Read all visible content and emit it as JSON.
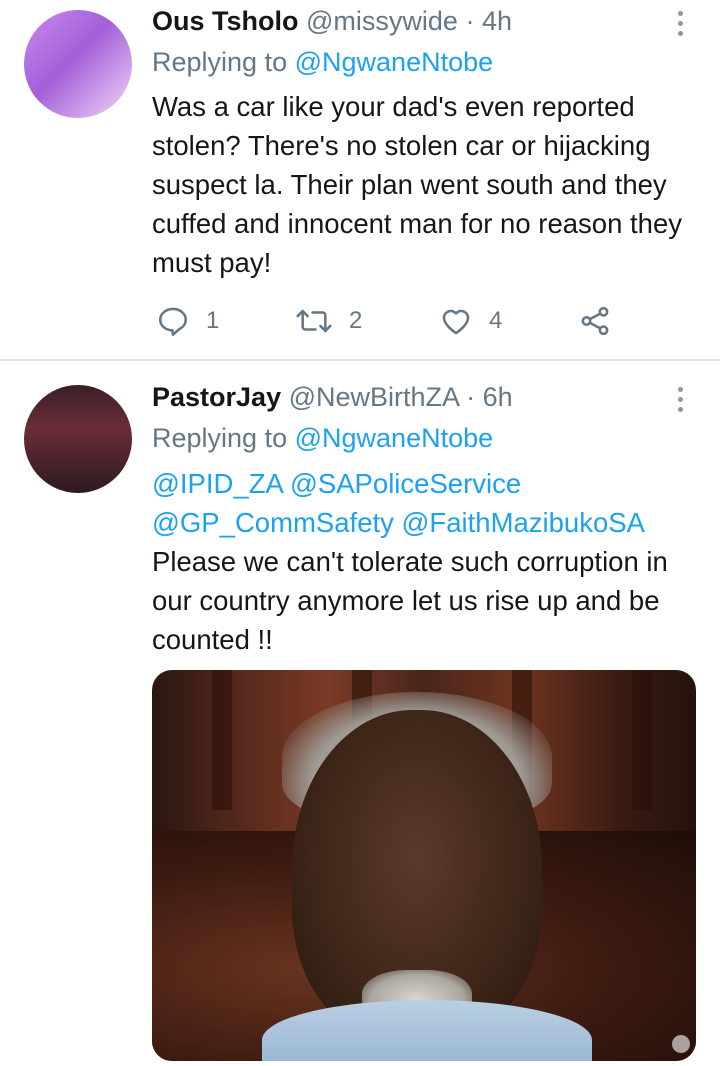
{
  "tweets": [
    {
      "author_name": "Ous Tsholo",
      "author_handle": "@missywide",
      "separator": "·",
      "time": "4h",
      "replying_prefix": "Replying to",
      "replying_to": "@NgwaneNtobe",
      "text": "Was a car like your dad's even reported stolen? There's no stolen car or hijacking suspect la. Their plan went south and they cuffed and innocent man for no reason they must pay!",
      "stats": {
        "replies": "1",
        "retweets": "2",
        "likes": "4"
      }
    },
    {
      "author_name": "PastorJay",
      "author_handle": "@NewBirthZA",
      "separator": "·",
      "time": "6h",
      "replying_prefix": "Replying to",
      "replying_to": "@NgwaneNtobe",
      "mentions": "@IPID_ZA @SAPoliceService @GP_CommSafety @FaithMazibukoSA",
      "text": "Please we can't tolerate such corruption in our country anymore let us rise up and be counted !!"
    }
  ],
  "colors": {
    "text": "#14171a",
    "secondary": "#657786",
    "link": "#1da1f2",
    "divider": "#dfe3e6"
  },
  "icons": [
    "reply-icon",
    "retweet-icon",
    "like-icon",
    "share-icon",
    "more-icon"
  ]
}
